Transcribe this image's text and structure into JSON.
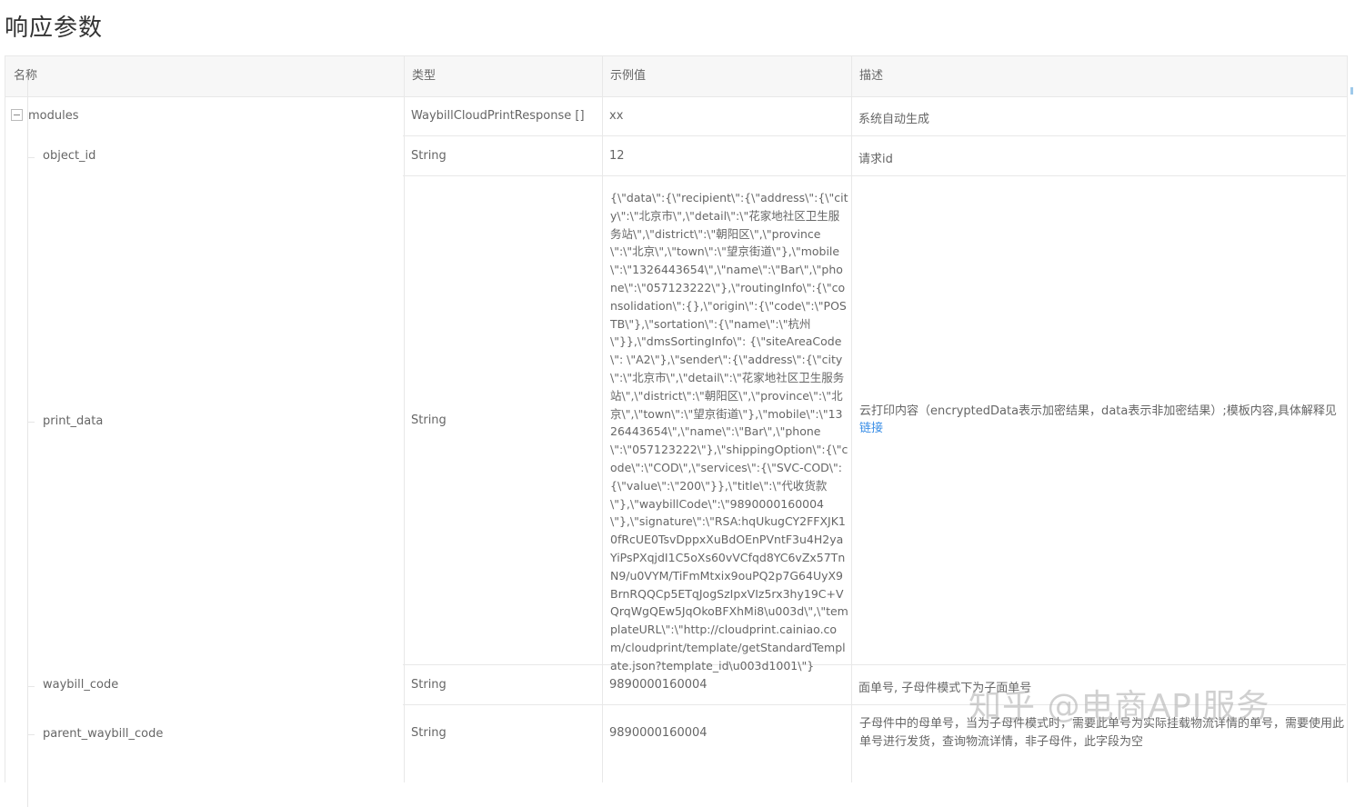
{
  "page": {
    "title": "响应参数"
  },
  "table": {
    "headers": [
      "名称",
      "类型",
      "示例值",
      "描述"
    ],
    "rows": [
      {
        "name": "modules",
        "type": "WaybillCloudPrintResponse []",
        "example": "xx",
        "description": "系统自动生成"
      },
      {
        "name": "object_id",
        "type": "String",
        "example": "12",
        "description": "请求id"
      },
      {
        "name": "print_data",
        "type": "String",
        "example": "{\\\"data\\\":{\\\"recipient\\\":{\\\"address\\\":{\\\"city\\\":\\\"北京市\\\",\\\"detail\\\":\\\"花家地社区卫生服务站\\\",\\\"district\\\":\\\"朝阳区\\\",\\\"province\\\":\\\"北京\\\",\\\"town\\\":\\\"望京街道\\\"},\\\"mobile\\\":\\\"1326443654\\\",\\\"name\\\":\\\"Bar\\\",\\\"phone\\\":\\\"057123222\\\"},\\\"routingInfo\\\":{\\\"consolidation\\\":{},\\\"origin\\\":{\\\"code\\\":\\\"POSTB\\\"},\\\"sortation\\\":{\\\"name\\\":\\\"杭州\\\"}},\\\"dmsSortingInfo\\\": {\\\"siteAreaCode\\\": \\\"A2\\\"},\\\"sender\\\":{\\\"address\\\":{\\\"city\\\":\\\"北京市\\\",\\\"detail\\\":\\\"花家地社区卫生服务站\\\",\\\"district\\\":\\\"朝阳区\\\",\\\"province\\\":\\\"北京\\\",\\\"town\\\":\\\"望京街道\\\"},\\\"mobile\\\":\\\"1326443654\\\",\\\"name\\\":\\\"Bar\\\",\\\"phone\\\":\\\"057123222\\\"},\\\"shippingOption\\\":{\\\"code\\\":\\\"COD\\\",\\\"services\\\":{\\\"SVC-COD\\\":{\\\"value\\\":\\\"200\\\"}},\\\"title\\\":\\\"代收货款\\\"},\\\"waybillCode\\\":\\\"9890000160004\\\"},\\\"signature\\\":\\\"RSA:hqUkugCY2FFXJK10fRcUE0TsvDppxXuBdOEnPVntF3u4H2yaYiPsPXqjdI1C5oXs60vVCfqd8YC6vZx57TnN9/u0VYM/TiFmMtxix9ouPQ2p7G64UyX9BrnRQQCp5ETqJogSzIpxVIz5rx3hy19C+VQrqWgQEw5JqOkoBFXhMi8\\u003d\\\",\\\"templateURL\\\":\\\"http://cloudprint.cainiao.com/cloudprint/template/getStandardTemplate.json?template_id\\u003d1001\\\"}",
        "description": "云打印内容（encryptedData表示加密结果，data表示非加密结果）;模板内容,具体解释见",
        "description_link": "链接"
      },
      {
        "name": "waybill_code",
        "type": "String",
        "example": "9890000160004",
        "description": "面单号, 子母件模式下为子面单号"
      },
      {
        "name": "parent_waybill_code",
        "type": "String",
        "example": "9890000160004",
        "description": "子母件中的母单号，当为子母件模式时，需要此单号为实际挂载物流详情的单号，需要使用此单号进行发货，查询物流详情，非子母件，此字段为空"
      }
    ]
  },
  "watermark": "知乎 @电商API服务"
}
